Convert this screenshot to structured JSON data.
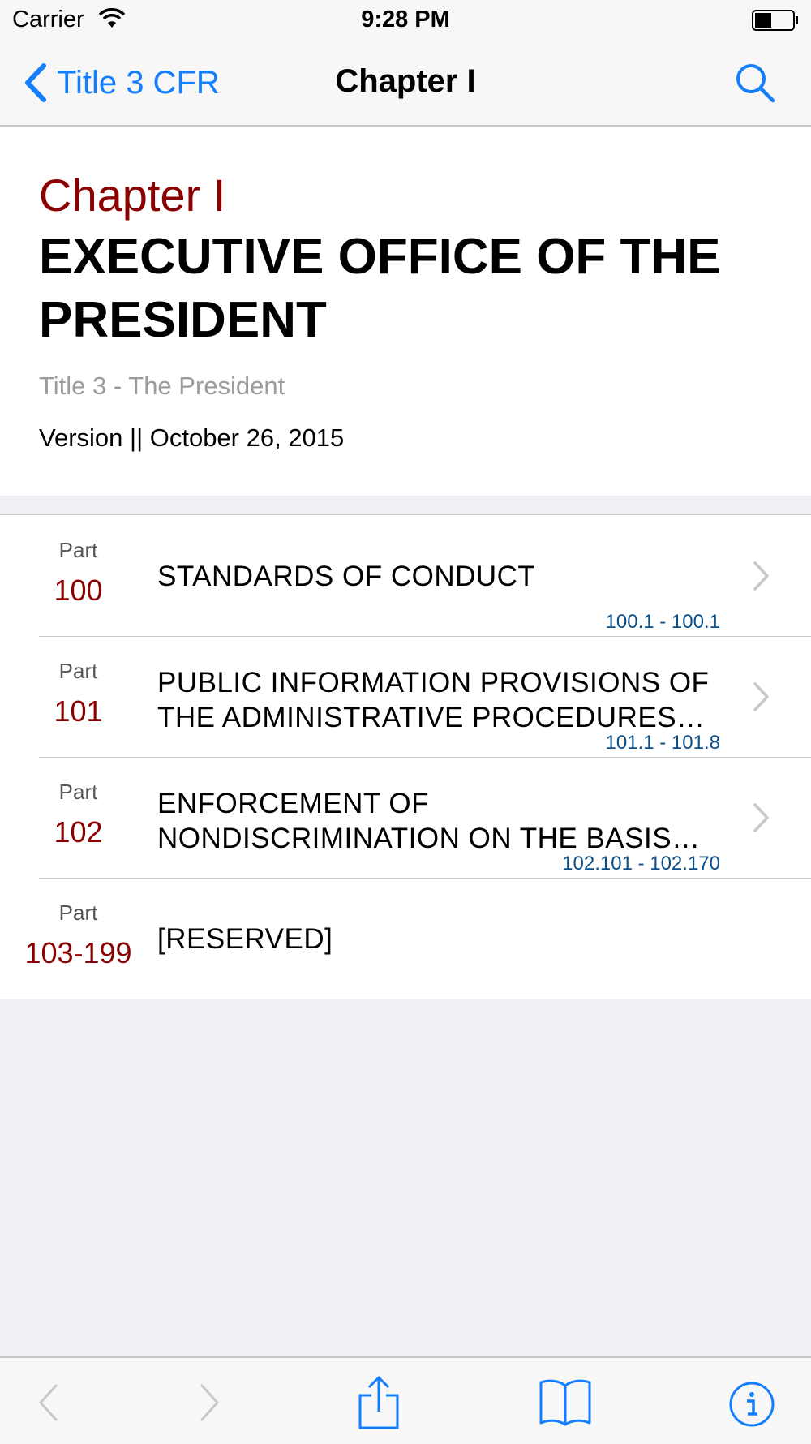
{
  "status_bar": {
    "carrier": "Carrier",
    "time": "9:28 PM"
  },
  "nav": {
    "back_label": "Title 3 CFR",
    "title": "Chapter I"
  },
  "header": {
    "chapter_label": "Chapter I",
    "chapter_title": "EXECUTIVE OFFICE OF THE PRESIDENT",
    "subtitle": "Title 3 - The President",
    "version": "Version || October 26, 2015"
  },
  "parts": [
    {
      "label": "Part",
      "number": "100",
      "title": "STANDARDS OF CONDUCT",
      "range": "100.1 - 100.1"
    },
    {
      "label": "Part",
      "number": "101",
      "title": "PUBLIC INFORMATION PROVISIONS OF THE ADMINISTRATIVE PROCEDURES…",
      "range": "101.1 - 101.8"
    },
    {
      "label": "Part",
      "number": "102",
      "title": "ENFORCEMENT OF NONDISCRIMINATION ON THE BASIS…",
      "range": "102.101 - 102.170"
    },
    {
      "label": "Part",
      "number": "103-199",
      "title": "[RESERVED]",
      "range": ""
    }
  ],
  "toolbar": {
    "items": [
      "back-arrow-icon",
      "forward-arrow-icon",
      "share-icon",
      "bookmarks-icon",
      "info-icon"
    ]
  },
  "colors": {
    "accent": "#147efb",
    "part_number": "#8b0000",
    "range": "#0b4f8a",
    "background": "#efeff4"
  }
}
